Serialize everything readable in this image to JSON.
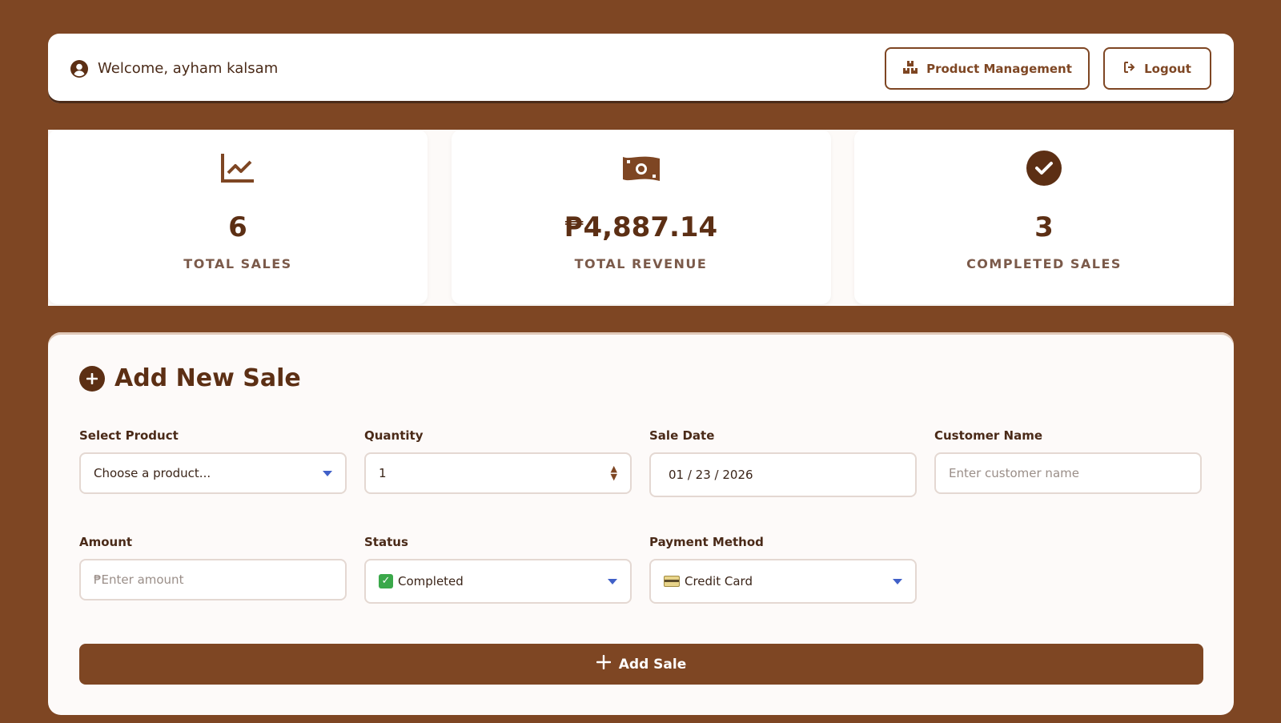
{
  "header": {
    "welcome": "Welcome, ayham kalsam",
    "product_management": "Product Management",
    "logout": "Logout"
  },
  "stats": [
    {
      "value": "6",
      "label": "TOTAL SALES",
      "icon": "chart-line-icon"
    },
    {
      "value": "₱4,887.14",
      "label": "TOTAL REVENUE",
      "icon": "money-bill-icon"
    },
    {
      "value": "3",
      "label": "COMPLETED SALES",
      "icon": "check-circle-icon"
    }
  ],
  "form": {
    "title": "Add New Sale",
    "product": {
      "label": "Select Product",
      "value": "Choose a product..."
    },
    "quantity": {
      "label": "Quantity",
      "value": "1"
    },
    "sale_date": {
      "label": "Sale Date",
      "value": "01 / 23 / 2026"
    },
    "customer": {
      "label": "Customer Name",
      "placeholder": "Enter customer name"
    },
    "amount": {
      "label": "Amount",
      "placeholder": "₱Enter amount"
    },
    "status": {
      "label": "Status",
      "value": "Completed"
    },
    "payment": {
      "label": "Payment Method",
      "value": "Credit Card"
    },
    "submit": "Add Sale"
  },
  "colors": {
    "background": "#7e4623",
    "accent": "#7e4623",
    "dark": "#5c2f14"
  }
}
